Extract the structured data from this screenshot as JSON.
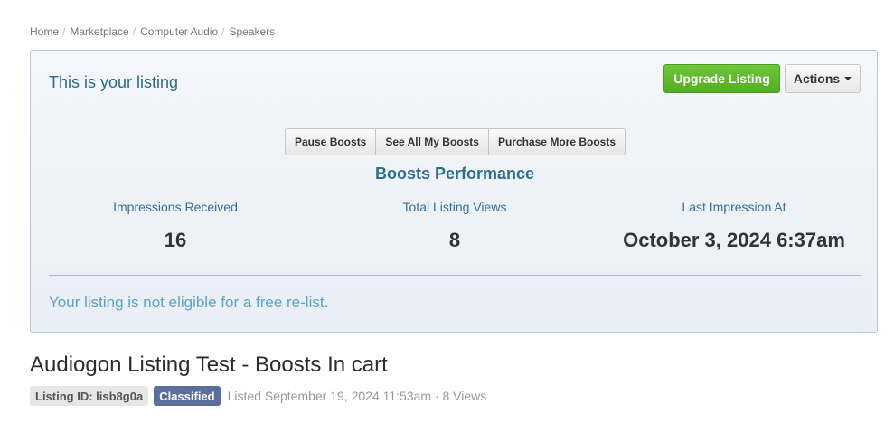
{
  "breadcrumb": {
    "items": [
      "Home",
      "Marketplace",
      "Computer Audio",
      "Speakers"
    ],
    "separator": "/"
  },
  "panel": {
    "title": "This is your listing",
    "upgrade_label": "Upgrade Listing",
    "actions_label": "Actions",
    "boost_buttons": [
      "Pause Boosts",
      "See All My Boosts",
      "Purchase More Boosts"
    ],
    "performance_title": "Boosts Performance",
    "stats": [
      {
        "label": "Impressions Received",
        "value": "16"
      },
      {
        "label": "Total Listing Views",
        "value": "8"
      },
      {
        "label": "Last Impression At",
        "value": "October 3, 2024 6:37am"
      }
    ],
    "relist_note": "Your listing is not eligible for a free re-list."
  },
  "listing": {
    "title": "Audiogon Listing Test - Boosts In cart",
    "id_badge": "Listing ID: lisb8g0a",
    "type_badge": "Classified",
    "listed_text": "Listed September 19, 2024 11:53am · 8 Views"
  },
  "colors": {
    "upgrade_green": "#5cb82a",
    "title_blue": "#2b6b8a",
    "classified_badge": "#5a6f9e"
  },
  "icons": {
    "actions_caret": "caret-down-icon"
  }
}
